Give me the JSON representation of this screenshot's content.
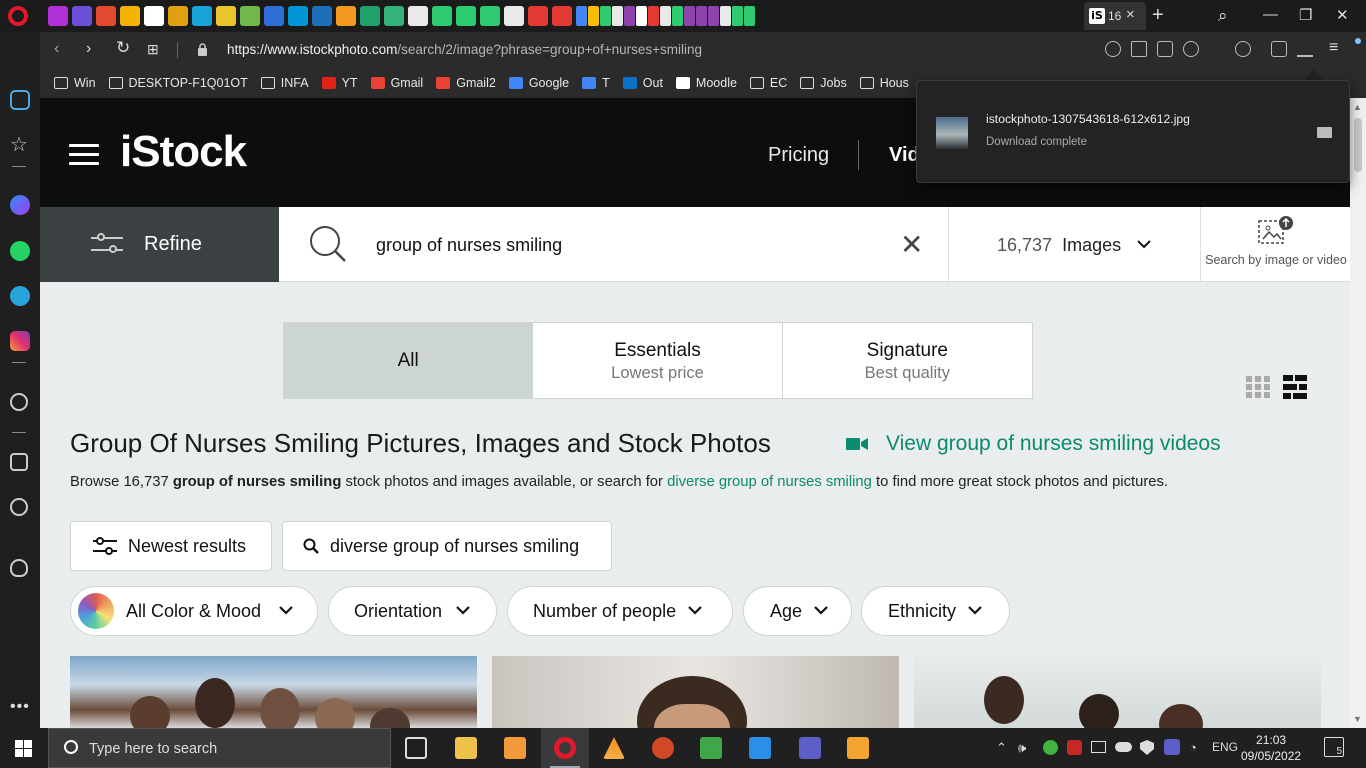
{
  "browser": {
    "active_tab": {
      "favicon_label": "iS",
      "title": "16",
      "close": "×"
    },
    "new_tab": "+",
    "url_host": "https://www.istockphoto.com",
    "url_path": "/search/2/image?phrase=group+of+nurses+smiling",
    "window_controls": {
      "search": "⌕",
      "minimize": "—",
      "restore": "❐",
      "close": "✕"
    },
    "tab_favicon_colors": [
      "#b02fd6",
      "#6b4fd8",
      "#e2492f",
      "#f2b400",
      "#ffffff",
      "#e0a010",
      "#1aa3d6",
      "#e8c52b",
      "#71b84a",
      "#2d6fd6",
      "#0096d6",
      "#1d6fb8",
      "#f29a1d",
      "#22a06b",
      "#33b27a",
      "#e9e9e9",
      "#2ecc71",
      "#2ecc71",
      "#2ecc71",
      "#e9e9e9",
      "#e53935",
      "#e53935",
      "#4285f4",
      "#fbbc05",
      "#2ecc71",
      "#e9e9e9",
      "#8e44ad",
      "#ffffff",
      "#e53935",
      "#e9e9e9",
      "#2ecc71",
      "#8e44ad",
      "#8e44ad",
      "#8e44ad",
      "#e9e9e9",
      "#2ecc71",
      "#2ecc71"
    ]
  },
  "bookmarks": [
    {
      "label": "Win",
      "icon": "folder-icon"
    },
    {
      "label": "DESKTOP-F1Q01OT",
      "icon": "folder-icon"
    },
    {
      "label": "INFA",
      "icon": "folder-icon"
    },
    {
      "label": "YT",
      "icon": "youtube-icon",
      "color": "#e62117"
    },
    {
      "label": "Gmail",
      "icon": "gmail-icon",
      "color": "#ea4335"
    },
    {
      "label": "Gmail2",
      "icon": "gmail-icon",
      "color": "#ea4335"
    },
    {
      "label": "Google",
      "icon": "google-icon",
      "color": "#4285f4"
    },
    {
      "label": "T",
      "icon": "translate-icon",
      "color": "#4285f4"
    },
    {
      "label": "Out",
      "icon": "outlook-icon",
      "color": "#0a72c6"
    },
    {
      "label": "Moodle",
      "icon": "moodle-icon",
      "color": "#ffffff"
    },
    {
      "label": "EC",
      "icon": "folder-icon"
    },
    {
      "label": "Jobs",
      "icon": "folder-icon"
    },
    {
      "label": "Hous",
      "icon": "folder-icon"
    }
  ],
  "download_popup": {
    "filename": "istockphoto-1307543618-612x612.jpg",
    "status": "Download complete"
  },
  "istock": {
    "logo": "iStock",
    "nav": {
      "pricing": "Pricing",
      "videos": "Vid"
    },
    "refine_label": "Refine",
    "search_query": "group of nurses smiling",
    "clear_symbol": "✕",
    "result_count": "16,737",
    "result_type": "Images",
    "search_by_image_label": "Search by image or video",
    "license_tabs": [
      {
        "title": "All",
        "subtitle": "",
        "selected": true
      },
      {
        "title": "Essentials",
        "subtitle": "Lowest price",
        "selected": false
      },
      {
        "title": "Signature",
        "subtitle": "Best quality",
        "selected": false
      }
    ],
    "page_title": "Group Of Nurses Smiling Pictures, Images and Stock Photos",
    "video_link": "View group of nurses smiling videos",
    "description": {
      "prefix": "Browse 16,737 ",
      "bold": "group of nurses smiling",
      "middle": " stock photos and images available, or search for ",
      "link": "diverse group of nurses smiling",
      "suffix": " to find more great stock photos and pictures."
    },
    "sort_button": "Newest results",
    "related_search": "diverse group of nurses smiling",
    "filters": [
      "All Color & Mood",
      "Orientation",
      "Number of people",
      "Age",
      "Ethnicity"
    ],
    "brand_color": "#0c8a6f"
  },
  "taskbar": {
    "search_placeholder": "Type here to search",
    "language": "ENG",
    "time": "21:03",
    "date": "09/05/2022",
    "notification_count": "5"
  }
}
